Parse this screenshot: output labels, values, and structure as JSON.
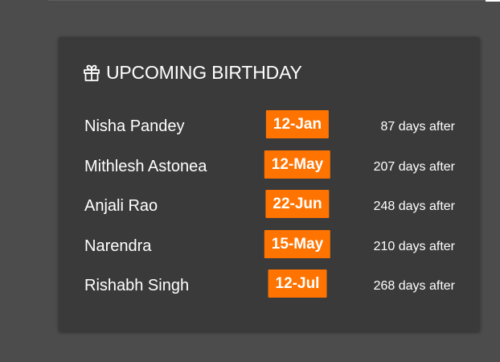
{
  "widget": {
    "title": "UPCOMING BIRTHDAY",
    "icon": "gift-icon",
    "accent_color": "#ff7300",
    "card_color": "#3a3a3a",
    "background_color": "#4c4c4c",
    "birthdays": [
      {
        "name": "Nisha Pandey",
        "date": "12-Jan",
        "days_after": "87 days after"
      },
      {
        "name": "Mithlesh Astonea",
        "date": "12-May",
        "days_after": "207 days after"
      },
      {
        "name": "Anjali Rao",
        "date": "22-Jun",
        "days_after": "248 days after"
      },
      {
        "name": "Narendra",
        "date": "15-May",
        "days_after": "210 days after"
      },
      {
        "name": "Rishabh Singh",
        "date": "12-Jul",
        "days_after": "268 days after"
      }
    ]
  }
}
